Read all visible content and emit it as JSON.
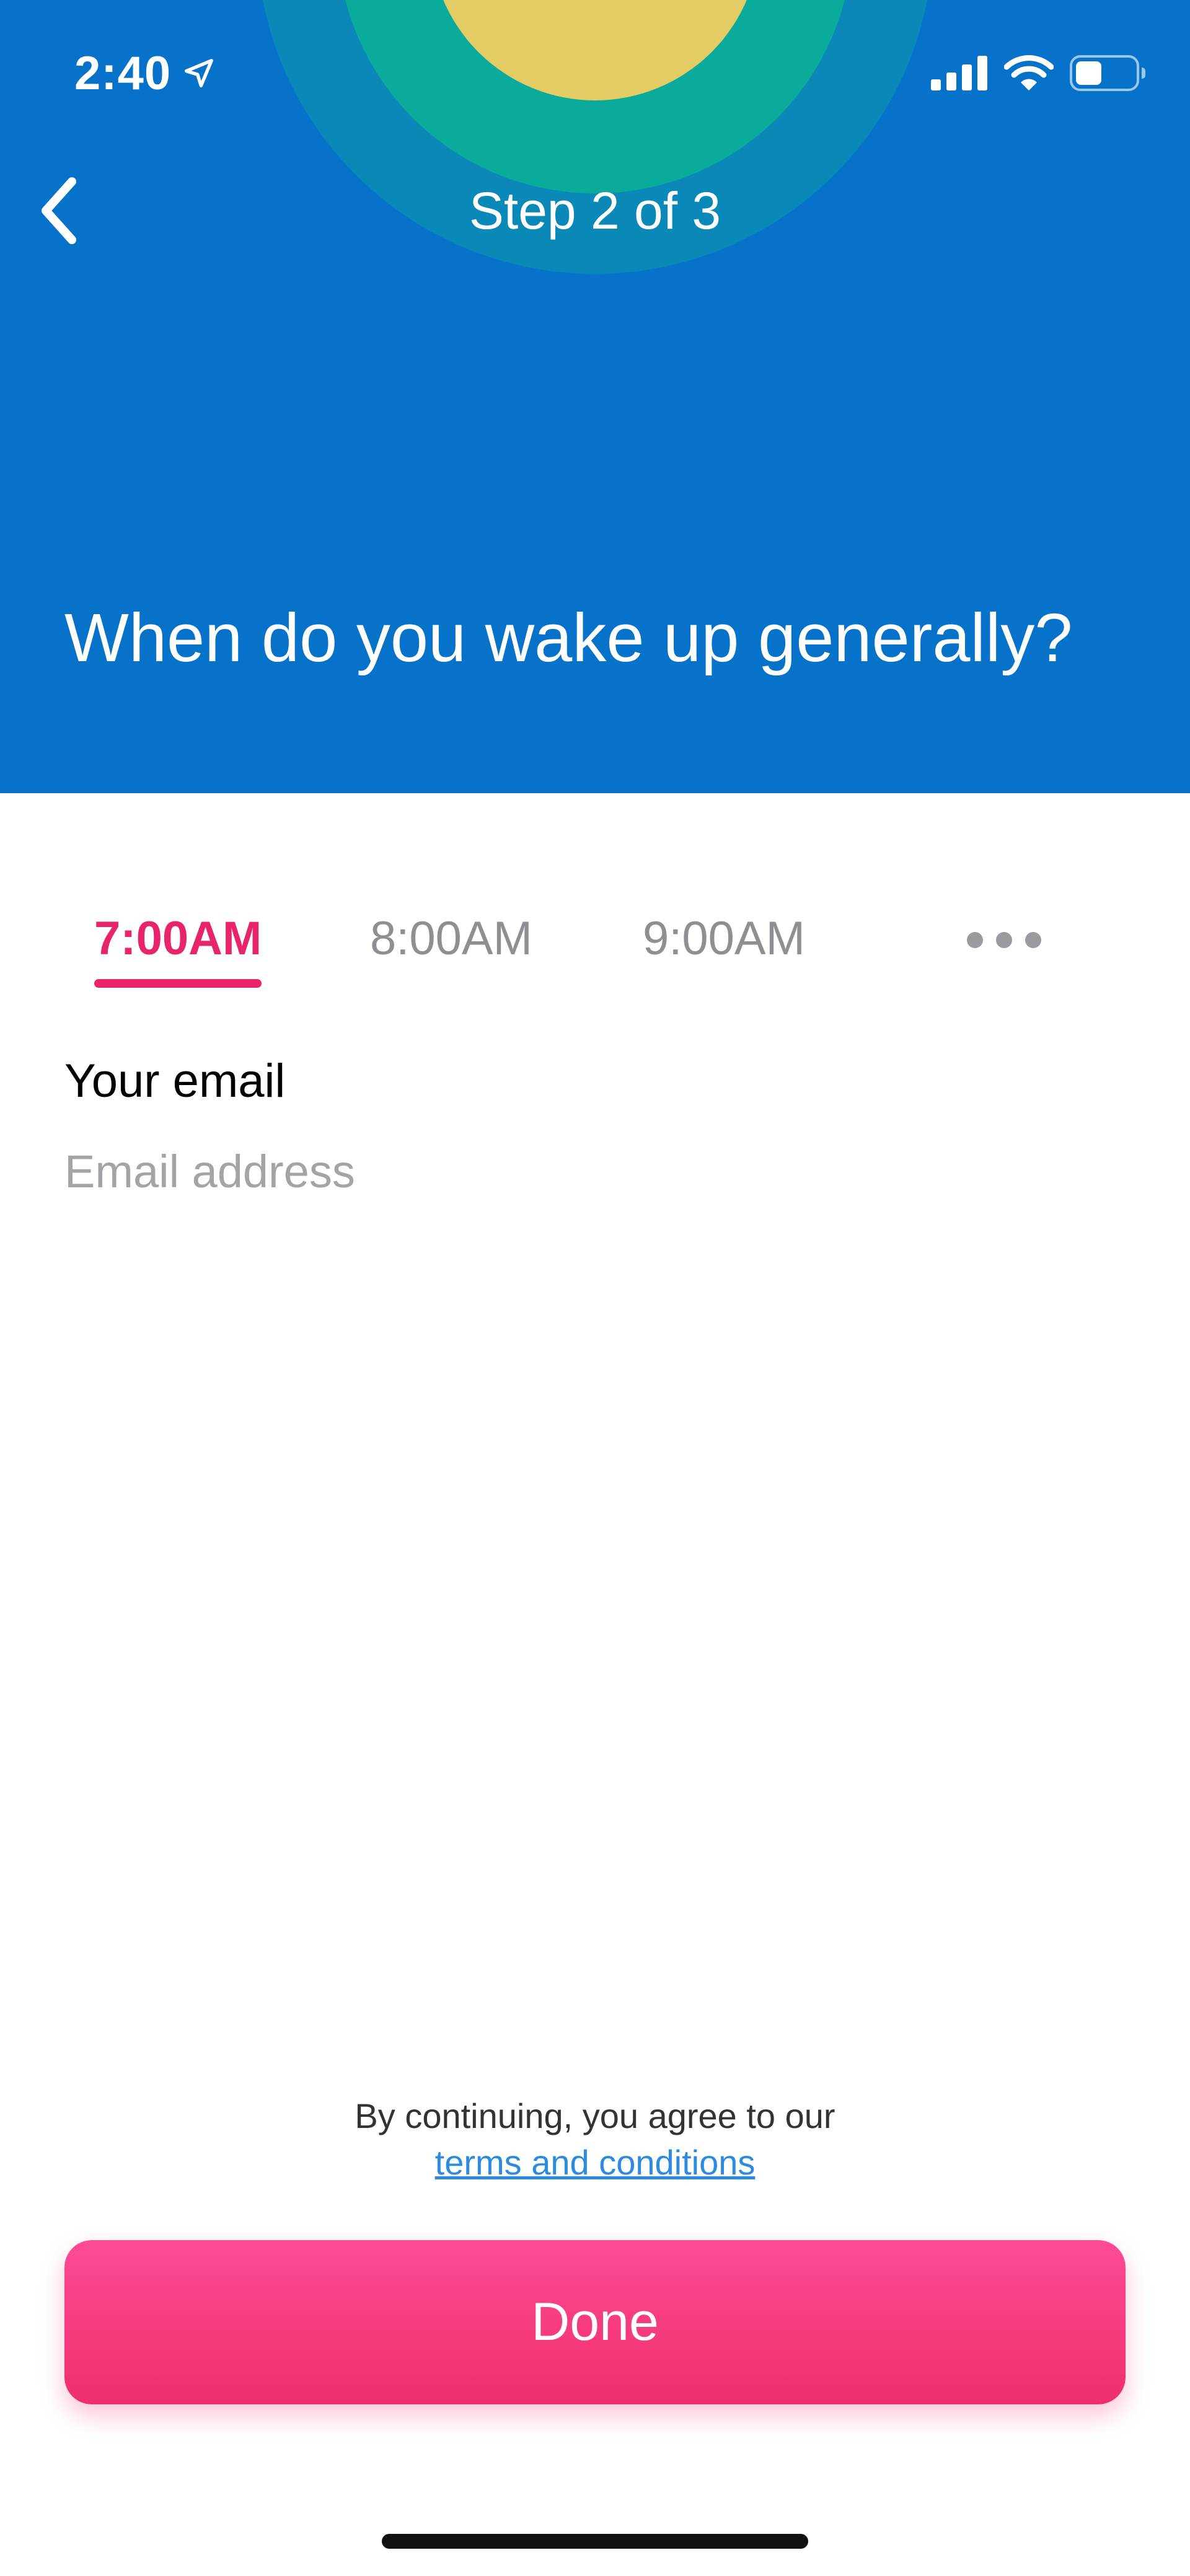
{
  "status_bar": {
    "time": "2:40",
    "location_icon": "location-arrow-icon",
    "signal_icon": "cellular-signal-icon",
    "wifi_icon": "wifi-icon",
    "battery_icon": "battery-icon",
    "battery_level": 0.45
  },
  "header": {
    "back_icon": "chevron-left-icon",
    "step_label": "Step 2 of 3",
    "question": "When do you wake up generally?",
    "colors": {
      "background": "#0672c9",
      "ring_outer": "#0a89b9",
      "ring_mid": "#0bab9b",
      "ring_inner": "#e3cc63"
    }
  },
  "time_options": {
    "items": [
      {
        "label": "7:00AM",
        "selected": true
      },
      {
        "label": "8:00AM",
        "selected": false
      },
      {
        "label": "9:00AM",
        "selected": false
      }
    ],
    "more_icon": "more-horizontal-icon",
    "accent_color": "#e8256b"
  },
  "email": {
    "label": "Your email",
    "value": "",
    "placeholder": "Email address"
  },
  "footer": {
    "agreement_text": "By continuing, you agree to our",
    "terms_link": "terms and conditions",
    "done_label": "Done",
    "button_color": "#ef2d6c",
    "link_color": "#2a8be0"
  }
}
